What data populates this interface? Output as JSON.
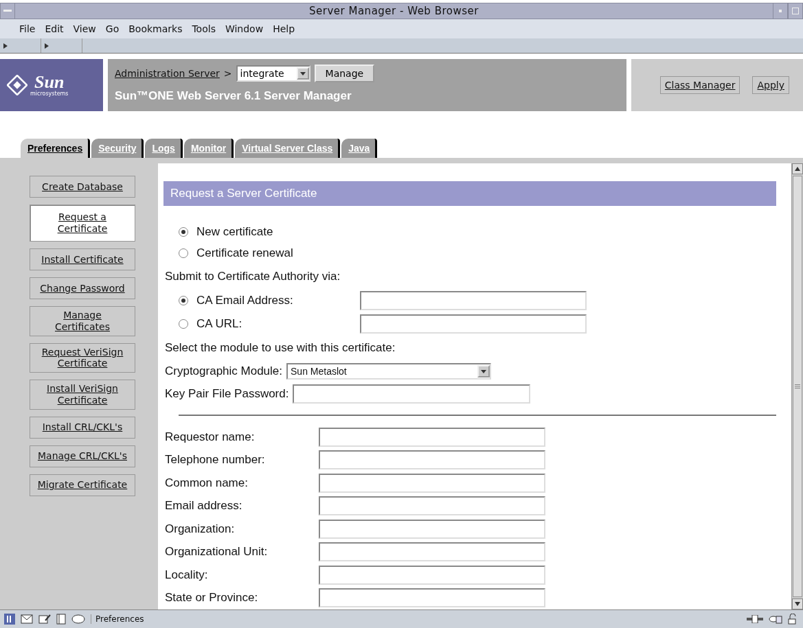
{
  "window": {
    "title": "Server Manager - Web Browser"
  },
  "menu": [
    "File",
    "Edit",
    "View",
    "Go",
    "Bookmarks",
    "Tools",
    "Window",
    "Help"
  ],
  "header": {
    "logo_text": "Sun",
    "logo_subtext": "microsystems",
    "breadcrumb_link": "Administration Server",
    "separator": ">",
    "server_select": "integrate",
    "manage_button": "Manage",
    "product_title": "Sun™ONE Web Server 6.1 Server Manager",
    "buttons": [
      "Class Manager",
      "Apply"
    ]
  },
  "tabs": [
    {
      "label": "Preferences",
      "selected": true
    },
    {
      "label": "Security",
      "selected": false
    },
    {
      "label": "Logs",
      "selected": false
    },
    {
      "label": "Monitor",
      "selected": false
    },
    {
      "label": "Virtual Server Class",
      "selected": false
    },
    {
      "label": "Java",
      "selected": false
    }
  ],
  "sidebar": {
    "items": [
      {
        "label": "Create Database",
        "selected": false
      },
      {
        "label": "Request a Certificate",
        "selected": true
      },
      {
        "label": "Install Certificate",
        "selected": false
      },
      {
        "label": "Change Password",
        "selected": false
      },
      {
        "label": "Manage Certificates",
        "selected": false
      },
      {
        "label": "Request VeriSign Certificate",
        "selected": false
      },
      {
        "label": "Install VeriSign Certificate",
        "selected": false
      },
      {
        "label": "Install CRL/CKL's",
        "selected": false
      },
      {
        "label": "Manage CRL/CKL's",
        "selected": false
      },
      {
        "label": "Migrate Certificate",
        "selected": false
      }
    ]
  },
  "form": {
    "title": "Request a Server Certificate",
    "certificate_type": [
      {
        "label": "New certificate",
        "selected": true
      },
      {
        "label": "Certificate renewal",
        "selected": false
      }
    ],
    "submit_label": "Submit to Certificate Authority via:",
    "submit_via": [
      {
        "label": "CA Email Address:",
        "selected": true
      },
      {
        "label": "CA URL:",
        "selected": false
      }
    ],
    "module_label": "Select the module to use with this certificate:",
    "crypto_label": "Cryptographic Module:",
    "crypto_value": "Sun Metaslot",
    "password_label": "Key Pair File Password:",
    "requestor_fields": [
      "Requestor name:",
      "Telephone number:",
      "Common name:",
      "Email address:",
      "Organization:",
      "Organizational Unit:",
      "Locality:",
      "State or Province:"
    ]
  },
  "status_bar": {
    "text": "Preferences"
  }
}
